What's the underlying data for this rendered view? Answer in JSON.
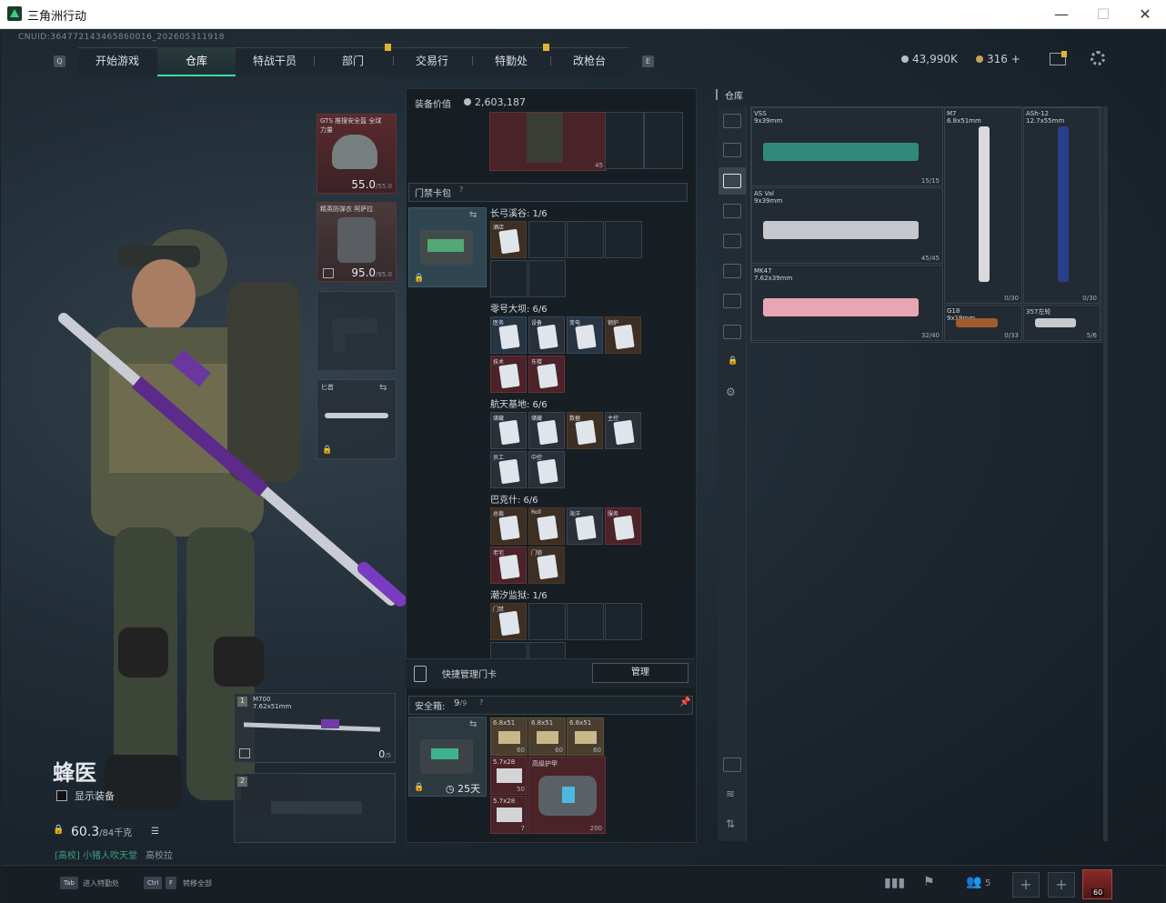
{
  "window": {
    "title": "三角洲行动",
    "minimize": "—",
    "maximize": "☐",
    "close": "✕"
  },
  "header": {
    "uid": "CNUID:364772143465860016_202605311918",
    "nav_key_left": "Q",
    "nav_key_right": "E",
    "tabs": [
      "开始游戏",
      "仓库",
      "特战干员",
      "部门",
      "交易行",
      "特勤处",
      "改枪台"
    ],
    "active_tab": "仓库",
    "silver": "43,990K",
    "gold": "316",
    "gold_add": "+"
  },
  "operator": {
    "name": "蜂医",
    "show_gear_label": "显示装备",
    "weight": "60.3",
    "weight_max": "/84千克",
    "status": "[高校] 小猪人吹天堂",
    "status_right": "高校拉"
  },
  "gear": {
    "helmet": {
      "label": "GTS 推搜安全盔 全球力量",
      "durability": "55.0",
      "max": "/55.0"
    },
    "armor": {
      "label": "精英防弹衣 阿萨拉",
      "durability": "95.0",
      "max": "/95.0"
    },
    "knife": {
      "label": "匕首"
    },
    "primary": {
      "slot": "1",
      "name": "M700",
      "caliber": "7.62x51mm",
      "ammo": "0",
      "ammo_max": "/5"
    },
    "secondary": {
      "slot": "2"
    }
  },
  "center": {
    "value_label": "装备价值",
    "value": "2,603,187",
    "pants_count": "45",
    "keycard_title": "门禁卡包",
    "help": "?",
    "maps": [
      {
        "name": "长弓溪谷: 1/6",
        "cards": [
          {
            "tag": "酒店",
            "color": "brown"
          }
        ]
      },
      {
        "name": "零号大坝: 6/6",
        "cards": [
          {
            "tag": "医务",
            "color": "blue"
          },
          {
            "tag": "设备",
            "color": "dark"
          },
          {
            "tag": "变电",
            "color": "blue"
          },
          {
            "tag": "钢炉",
            "color": "brown"
          },
          {
            "tag": "技术",
            "color": "red"
          },
          {
            "tag": "东楼",
            "color": "red"
          }
        ]
      },
      {
        "name": "航天基地: 6/6",
        "cards": [
          {
            "tag": "储藏",
            "color": "dark"
          },
          {
            "tag": "储藏",
            "color": "dark"
          },
          {
            "tag": "数据",
            "color": "brown"
          },
          {
            "tag": "主控",
            "color": "dark"
          },
          {
            "tag": "员工",
            "color": "dark"
          },
          {
            "tag": "中控",
            "color": "dark"
          }
        ]
      },
      {
        "name": "巴克什: 6/6",
        "cards": [
          {
            "tag": "总裁",
            "color": "brown"
          },
          {
            "tag": "Roll",
            "color": "brown"
          },
          {
            "tag": "海洋",
            "color": "dark"
          },
          {
            "tag": "服务",
            "color": "red"
          },
          {
            "tag": "老宅",
            "color": "red"
          },
          {
            "tag": "门锁",
            "color": "brown"
          }
        ]
      },
      {
        "name": "潮汐监狱: 1/6",
        "cards": [
          {
            "tag": "门禁",
            "color": "brown"
          }
        ]
      }
    ],
    "manage_label": "快捷管理门卡",
    "manage_button": "管理",
    "safebox_label": "安全箱:",
    "safebox_used": "9",
    "safebox_max": "/9",
    "safebox_days": "25天",
    "ammo": [
      {
        "cal": "6.8x51",
        "n": "60"
      },
      {
        "cal": "6.8x51",
        "n": "60"
      },
      {
        "cal": "6.8x51",
        "n": "60"
      }
    ],
    "ammo2": {
      "cal": "5.7x28",
      "n": "50"
    },
    "ammo3": {
      "cal": "5.7x28",
      "n": "7"
    },
    "armor_plate": {
      "label": "高级护甲",
      "n": "200"
    }
  },
  "warehouse": {
    "title": "仓库",
    "items": [
      {
        "name": "VSS",
        "cal": "9x39mm",
        "count": "15/15"
      },
      {
        "name": "M7",
        "cal": "6.8x51mm",
        "count": "0/30"
      },
      {
        "name": "ASh-12",
        "cal": "12.7x55mm",
        "count": "0/30"
      },
      {
        "name": "AS Val",
        "cal": "9x39mm",
        "count": "45/45"
      },
      {
        "name": "MK47",
        "cal": "7.62x39mm",
        "count": "32/40"
      },
      {
        "name": "G18",
        "cal": "9x19mm",
        "count": "0/33"
      },
      {
        "name": "357左轮",
        "cal": "",
        "count": "5/6"
      }
    ]
  },
  "bottom": {
    "hint1_key": "Tab",
    "hint1": "进入特勤处",
    "hint2_key1": "Ctrl",
    "hint2_key2": "F",
    "hint2": "转移全部",
    "party_count": "5",
    "level": "60"
  },
  "colors": {
    "accent": "#41d6a8",
    "flag": "#e3b32f"
  }
}
